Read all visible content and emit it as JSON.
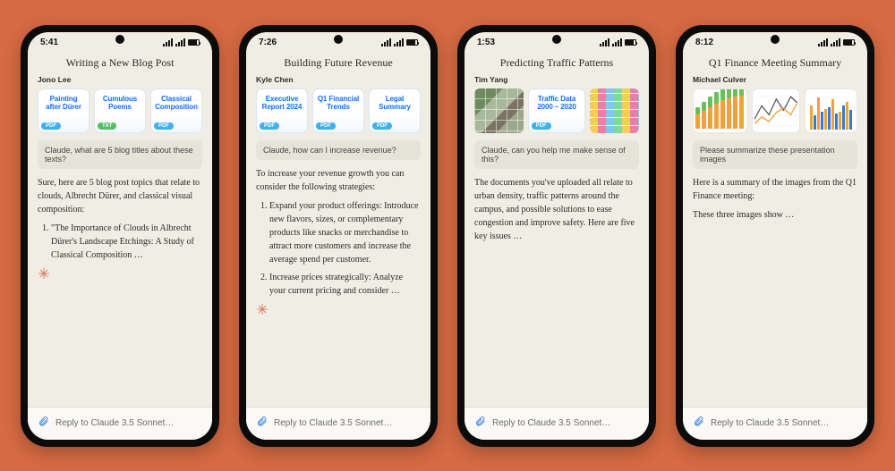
{
  "input_placeholder": "Reply to Claude 3.5 Sonnet…",
  "phones": [
    {
      "time": "5:41",
      "title": "Writing a New Blog Post",
      "author": "Jono Lee",
      "cards": [
        {
          "label": "Painting after Dürer",
          "filetype": "PDF"
        },
        {
          "label": "Cumulous Poems",
          "filetype": "TXT"
        },
        {
          "label": "Classical Composition",
          "filetype": "PDF"
        }
      ],
      "user_msg": "Claude, what are 5 blog titles about these texts?",
      "response_intro": "Sure, here are 5 blog post topics that relate to clouds, Albrecht Dürer, and classical visual composition:",
      "response_items": [
        "\"The Importance of Clouds in Albrecht Dürer's Landscape Etchings: A Study of Classical Composition …"
      ]
    },
    {
      "time": "7:26",
      "title": "Building Future Revenue",
      "author": "Kyle Chen",
      "cards": [
        {
          "label": "Executive Report 2024",
          "filetype": "PDF"
        },
        {
          "label": "Q1 Financial Trends",
          "filetype": "PDF"
        },
        {
          "label": "Legal Summary",
          "filetype": "PDF"
        }
      ],
      "user_msg": "Claude, how can I increase revenue?",
      "response_intro": "To increase your revenue growth you can consider the following strategies:",
      "response_items": [
        "Expand your product offerings: Introduce new flavors, sizes, or complementary products like snacks or merchandise to attract more customers and increase the average spend per customer.",
        "Increase prices strategically: Analyze your current pricing and consider …"
      ]
    },
    {
      "time": "1:53",
      "title": "Predicting Traffic Patterns",
      "author": "Tim Yang",
      "cards": [
        {
          "kind": "image",
          "label": "aerial"
        },
        {
          "label": "Traffic Data 2000 – 2020",
          "filetype": "PDF"
        },
        {
          "kind": "image",
          "label": "stickies"
        }
      ],
      "user_msg": "Claude, can you help me make sense of this?",
      "response_intro": "The documents you've uploaded all relate to urban density, traffic patterns around the campus, and possible solutions to ease congestion and improve safety. Here are five key issues …",
      "response_items": []
    },
    {
      "time": "8:12",
      "title": "Q1 Finance Meeting Summary",
      "author": "Michael Culver",
      "cards": [
        {
          "kind": "chart",
          "label": "bars"
        },
        {
          "kind": "chart",
          "label": "lines"
        },
        {
          "kind": "chart",
          "label": "grouped"
        }
      ],
      "user_msg": "Please summarize these presentation images",
      "response_p1": "Here is a summary of the images from the Q1 Finance meeting:",
      "response_p2": "These three images show …",
      "response_items": []
    }
  ],
  "chart_data": [
    {
      "type": "bar",
      "title": "",
      "categories": [
        "1",
        "2",
        "3",
        "4",
        "5",
        "6",
        "7",
        "8"
      ],
      "series": [
        {
          "name": "orange",
          "color": "#f1a13a",
          "values": [
            20,
            25,
            30,
            35,
            40,
            42,
            44,
            46
          ]
        },
        {
          "name": "green",
          "color": "#6bbf59",
          "values": [
            10,
            12,
            14,
            16,
            18,
            20,
            22,
            24
          ]
        }
      ],
      "ylim": [
        0,
        50
      ]
    },
    {
      "type": "line",
      "title": "",
      "x": [
        1,
        2,
        3,
        4,
        5,
        6,
        7
      ],
      "series": [
        {
          "name": "a",
          "color": "#555",
          "values": [
            10,
            22,
            14,
            28,
            18,
            30,
            24
          ]
        },
        {
          "name": "b",
          "color": "#f1a13a",
          "values": [
            6,
            12,
            8,
            16,
            20,
            14,
            26
          ]
        }
      ],
      "ylim": [
        0,
        35
      ]
    },
    {
      "type": "bar",
      "title": "",
      "categories": [
        "1",
        "2",
        "3",
        "4",
        "5",
        "6"
      ],
      "series": [
        {
          "name": "orange",
          "color": "#f1a13a",
          "values": [
            30,
            40,
            25,
            38,
            22,
            34
          ]
        },
        {
          "name": "blue",
          "color": "#2f7bd6",
          "values": [
            18,
            22,
            28,
            20,
            30,
            24
          ]
        }
      ],
      "ylim": [
        0,
        45
      ]
    }
  ]
}
